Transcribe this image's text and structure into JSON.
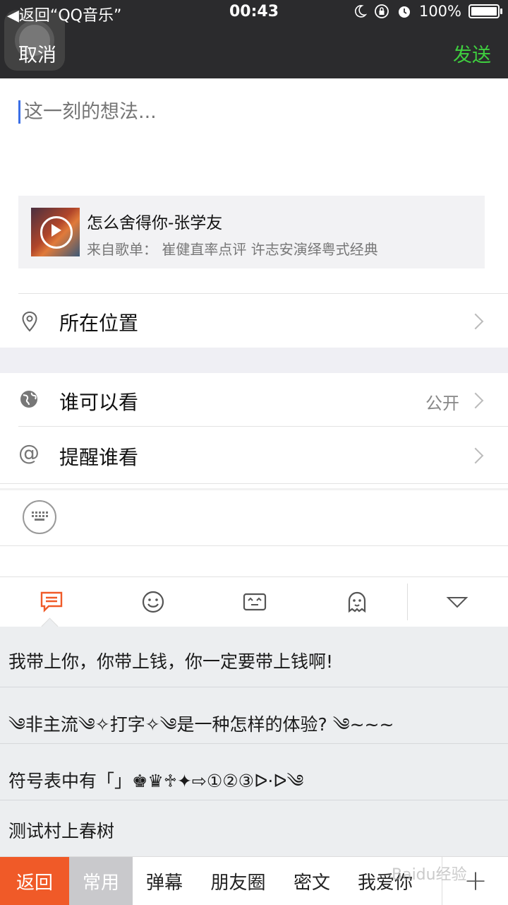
{
  "status_bar": {
    "back_label": "◀返回“QQ音乐”",
    "time": "00:43",
    "battery_text": "100%",
    "battery_level": 1.0
  },
  "nav": {
    "cancel_label": "取消",
    "send_label": "发送",
    "send_color": "#3fcf3f"
  },
  "compose": {
    "placeholder": "这一刻的想法..."
  },
  "music_card": {
    "title": "怎么舍得你-张学友",
    "source": "来自歌单： 崔健直率点评 许志安演绎粤式经典"
  },
  "rows": {
    "location": {
      "label": "所在位置"
    },
    "visibility": {
      "label": "谁可以看",
      "value": "公开"
    },
    "mention": {
      "label": "提醒谁看"
    }
  },
  "emoji_tabs": [
    "phrases-icon",
    "smiley-icon",
    "kaomoji-icon",
    "ghost-icon",
    "collapse-icon"
  ],
  "accent_color": "#f05a28",
  "phrases": [
    "我带上你，你带上钱，你一定要带上钱啊!",
    "༄非主流༄✧打字✧༄是一种怎样的体验?  ༄~~~",
    "符号表中有「」♚♛♱✦⇨①②③ᐅ·ᐅ༄",
    "测试村上春树"
  ],
  "categories": {
    "back": "返回",
    "common": "常用",
    "danmu": "弹幕",
    "moments": "朋友圈",
    "secret": "密文",
    "love": "我爱你",
    "add": "+"
  },
  "watermark": "Baidu经验"
}
